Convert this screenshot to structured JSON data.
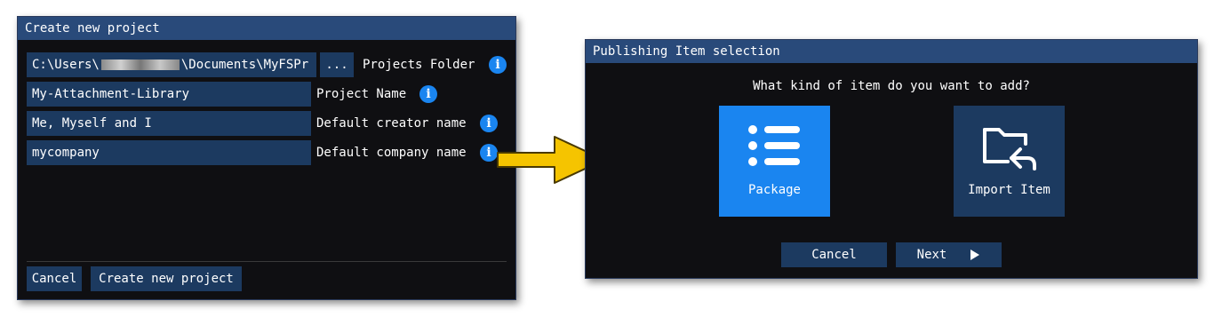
{
  "create_dialog": {
    "title": "Create new project",
    "folder_path": "C:\\Users\\",
    "folder_path_suffix": "\\Documents\\MyFSPr",
    "browse_label": "...",
    "projects_folder_label": "Projects Folder",
    "project_name_value": "My-Attachment-Library",
    "project_name_label": "Project Name",
    "creator_value": "Me, Myself and I",
    "creator_label": "Default creator name",
    "company_value": "mycompany",
    "company_label": "Default company name",
    "info_glyph": "i",
    "cancel_label": "Cancel",
    "create_label": "Create new project"
  },
  "publish_dialog": {
    "title": "Publishing Item selection",
    "question": "What kind of item do you want to add?",
    "tiles": [
      {
        "label": "Package",
        "icon": "list-icon",
        "selected": true
      },
      {
        "label": "Import Item",
        "icon": "folder-import-icon",
        "selected": false
      }
    ],
    "cancel_label": "Cancel",
    "next_label": "Next"
  },
  "colors": {
    "titlebar": "#294a7a",
    "field": "#1c3a60",
    "selected_tile": "#1a85f0",
    "arrow": "#f5c400"
  }
}
